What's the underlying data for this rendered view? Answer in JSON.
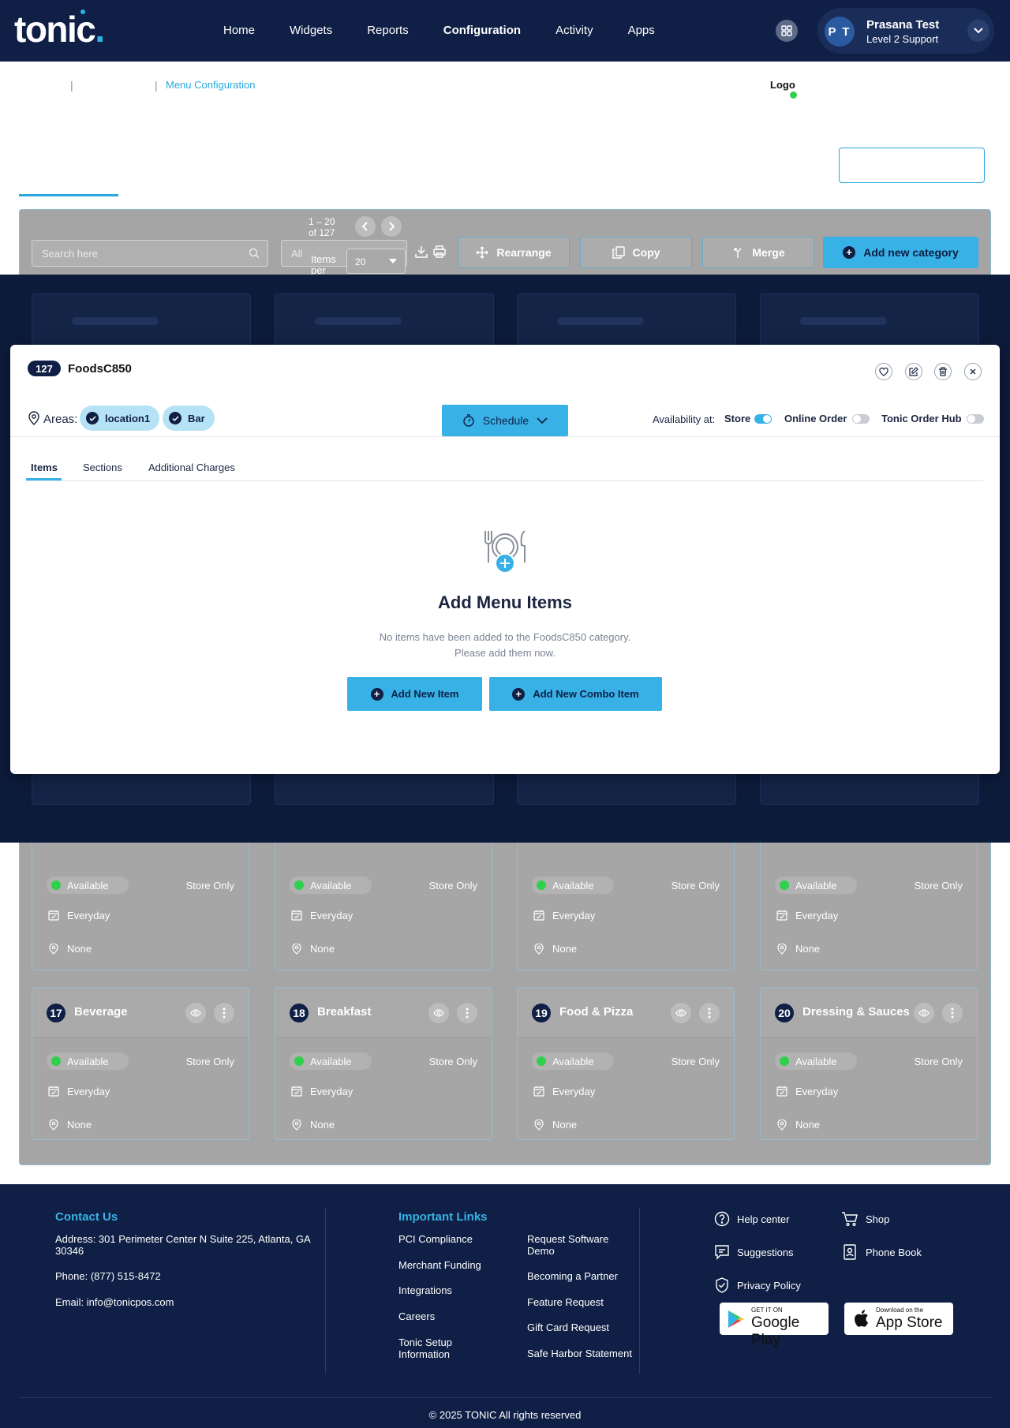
{
  "app": {
    "logo_text": "tonic"
  },
  "nav": {
    "items": [
      "Home",
      "Widgets",
      "Reports",
      "Configuration",
      "Activity",
      "Apps"
    ],
    "active": "Configuration"
  },
  "user": {
    "initials": "P T",
    "name": "Prasana Test",
    "role": "Level 2 Support"
  },
  "breadcrumb": {
    "current": "Menu Configuration"
  },
  "header": {
    "logo_label": "Logo"
  },
  "toolbar": {
    "search_placeholder": "Search here",
    "filter_value": "All",
    "range_line1": "1 – 20",
    "range_line2": "of 127",
    "items_per_page_label": "Items per page",
    "items_per_page_value": "20",
    "rearrange_label": "Rearrange",
    "copy_label": "Copy",
    "merge_label": "Merge",
    "add_category_label": "Add new category"
  },
  "cards_row": [
    {
      "num": "17",
      "title": "Beverage",
      "status": "Available",
      "channel": "Store Only",
      "schedule": "Everyday",
      "location": "None"
    },
    {
      "num": "18",
      "title": "Breakfast",
      "status": "Available",
      "channel": "Store Only",
      "schedule": "Everyday",
      "location": "None"
    },
    {
      "num": "19",
      "title": "Food & Pizza",
      "status": "Available",
      "channel": "Store Only",
      "schedule": "Everyday",
      "location": "None"
    },
    {
      "num": "20",
      "title": "Dressing & Sauces",
      "status": "Available",
      "channel": "Store Only",
      "schedule": "Everyday",
      "location": "None"
    }
  ],
  "cards_partial": [
    {
      "status": "Available",
      "channel": "Store Only",
      "schedule": "Everyday",
      "location": "None"
    },
    {
      "status": "Available",
      "channel": "Store Only",
      "schedule": "Everyday",
      "location": "None"
    },
    {
      "status": "Available",
      "channel": "Store Only",
      "schedule": "Everyday",
      "location": "None"
    },
    {
      "status": "Available",
      "channel": "Store Only",
      "schedule": "Everyday",
      "location": "None"
    }
  ],
  "modal": {
    "count": "127",
    "title": "FoodsC850",
    "areas_label": "Areas:",
    "areas": [
      "location1",
      "Bar"
    ],
    "schedule_label": "Schedule",
    "availability_label": "Availability at:",
    "toggles": [
      {
        "label": "Store",
        "on": true
      },
      {
        "label": "Online Order",
        "on": false
      },
      {
        "label": "Tonic Order Hub",
        "on": false
      }
    ],
    "tabs": [
      "Items",
      "Sections",
      "Additional Charges"
    ],
    "active_tab": "Items",
    "empty_title": "Add Menu Items",
    "empty_desc_line1": "No items have been added to the FoodsC850 category.",
    "empty_desc_line2": "Please add them now.",
    "add_item_label": "Add New Item",
    "add_combo_label": "Add New Combo Item"
  },
  "footer": {
    "contact_heading": "Contact Us",
    "address": "Address: 301 Perimeter Center N Suite 225, Atlanta, GA 30346",
    "phone": "Phone: (877) 515-8472",
    "email": "Email: info@tonicpos.com",
    "links_heading": "Important Links",
    "links_col1": [
      "PCI Compliance",
      "Merchant Funding",
      "Integrations",
      "Careers",
      "Tonic Setup Information"
    ],
    "links_col2": [
      "Request Software Demo",
      "Becoming a Partner",
      "Feature Request",
      "Gift Card Request",
      "Safe Harbor Statement"
    ],
    "utilities": [
      "Help center",
      "Shop",
      "Suggestions",
      "Phone Book",
      "Privacy Policy"
    ],
    "google_play_small": "GET IT ON",
    "google_play_big": "Google Play",
    "app_store_small": "Download on the",
    "app_store_big": "App Store",
    "copyright": "© 2025 TONIC All rights reserved"
  },
  "colors": {
    "navy": "#0f1f45",
    "accent": "#38b2e6",
    "available": "#2fd04c"
  }
}
